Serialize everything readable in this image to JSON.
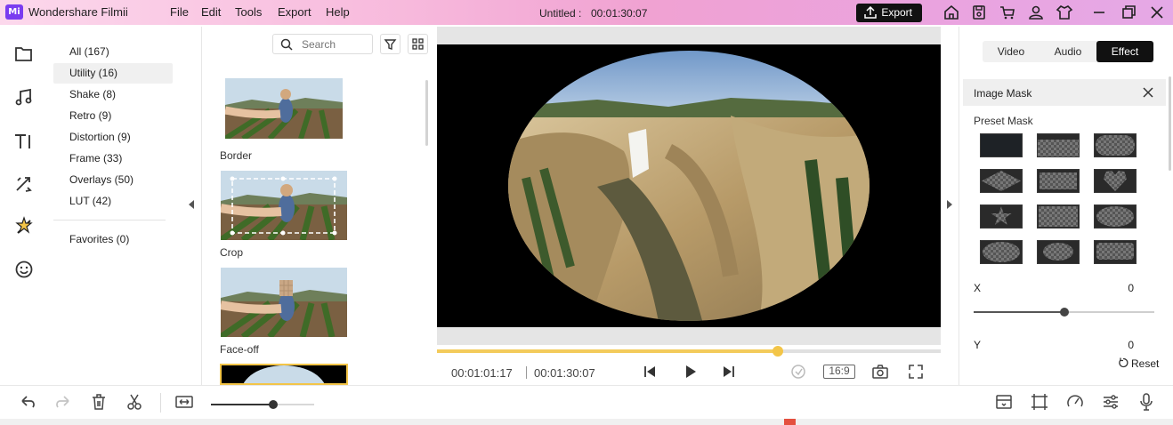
{
  "window": {
    "app_name": "Wondershare Filmii",
    "logo_text": "Mi",
    "doc_title": "Untitled :",
    "doc_time": "00:01:30:07",
    "menu": [
      "File",
      "Edit",
      "Tools",
      "Export",
      "Help"
    ],
    "export_label": "Export",
    "title_icons": [
      "home-icon",
      "save-icon",
      "cart-icon",
      "account-icon",
      "theme-icon"
    ],
    "window_controls": [
      "minimize-icon",
      "restore-icon",
      "close-icon"
    ]
  },
  "rail": {
    "icons": [
      "media-folder-icon",
      "music-note-icon",
      "text-title-icon",
      "transition-icon",
      "effects-sparkle-icon",
      "sticker-face-icon"
    ],
    "active_index": 4
  },
  "categories": {
    "items": [
      {
        "label": "All (167)"
      },
      {
        "label": "Utility (16)"
      },
      {
        "label": "Shake (8)"
      },
      {
        "label": "Retro (9)"
      },
      {
        "label": "Distortion (9)"
      },
      {
        "label": "Frame (33)"
      },
      {
        "label": "Overlays (50)"
      },
      {
        "label": "LUT (42)"
      }
    ],
    "active_index": 1,
    "favorites": "Favorites (0)"
  },
  "effects": {
    "search_placeholder": "Search",
    "items": [
      {
        "label": "Border"
      },
      {
        "label": "Crop"
      },
      {
        "label": "Face-off"
      },
      {
        "label": ""
      }
    ]
  },
  "player": {
    "current_time": "00:01:01:17",
    "total_time": "00:01:30:07",
    "progress": 0.677,
    "aspect_ratio": "16:9",
    "accent": "#f3c548"
  },
  "panel": {
    "tabs": [
      "Video",
      "Audio",
      "Effect"
    ],
    "active_tab": 2,
    "section_title": "Image Mask",
    "preset_label": "Preset Mask",
    "masks": [
      "none",
      "rectangle",
      "rounded-rect",
      "diamond",
      "rectangle",
      "heart",
      "star",
      "rectangle",
      "oval",
      "oval",
      "speech-bubble",
      "rect-bubble"
    ],
    "params": [
      {
        "label": "X",
        "value": "0",
        "slider": 0.5
      },
      {
        "label": "Y",
        "value": "0"
      }
    ],
    "reset_label": "Reset"
  },
  "timeline": {
    "zoom_level": 0.6
  }
}
